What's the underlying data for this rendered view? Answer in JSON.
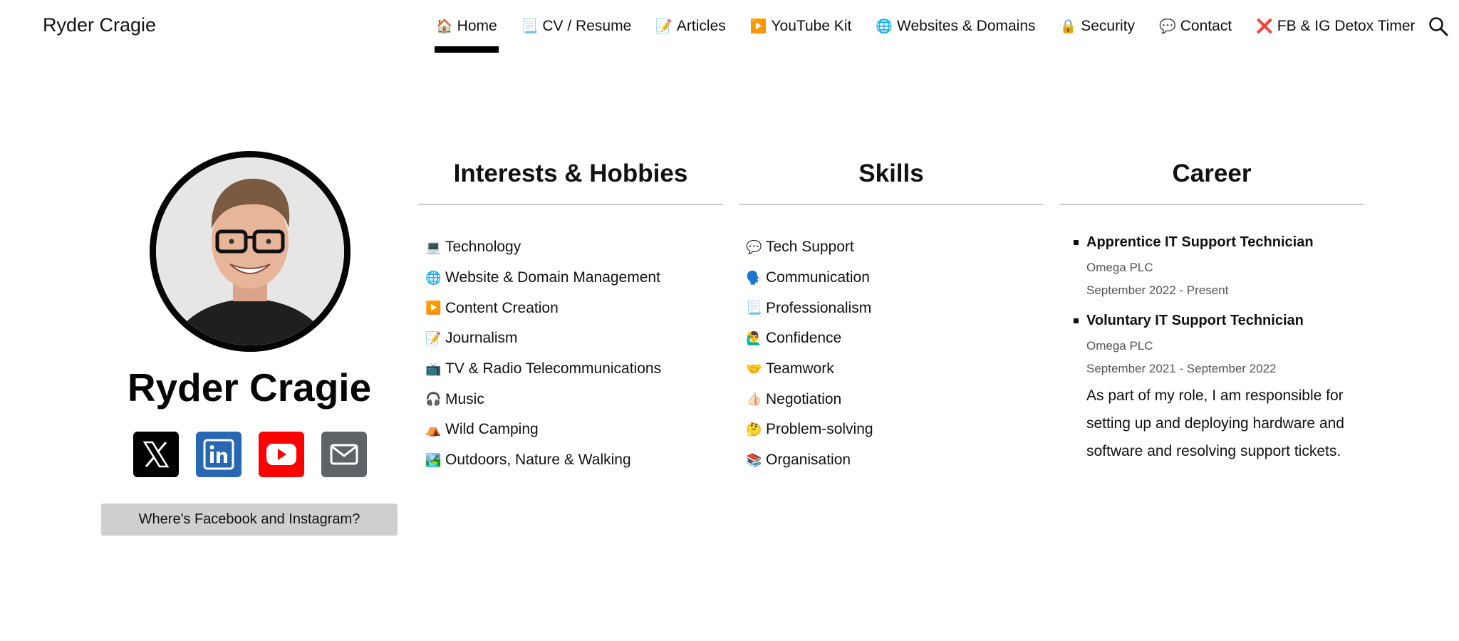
{
  "header": {
    "site_title": "Ryder Cragie",
    "nav": [
      {
        "emoji": "🏠",
        "label": "Home",
        "active": true
      },
      {
        "emoji": "📃",
        "label": "CV / Resume"
      },
      {
        "emoji": "📝",
        "label": "Articles"
      },
      {
        "emoji": "▶️",
        "label": "YouTube Kit"
      },
      {
        "emoji": "🌐",
        "label": "Websites & Domains"
      },
      {
        "emoji": "🔒",
        "label": "Security"
      },
      {
        "emoji": "💬",
        "label": "Contact"
      },
      {
        "emoji": "❌",
        "label": "FB & IG Detox Timer"
      }
    ],
    "search_icon": "search-icon"
  },
  "profile": {
    "name": "Ryder Cragie",
    "socials": [
      "x-icon",
      "linkedin-icon",
      "youtube-icon",
      "email-icon"
    ],
    "facebook_button": "Where's Facebook and Instagram?"
  },
  "interests": {
    "title": "Interests & Hobbies",
    "items": [
      {
        "emoji": "💻",
        "label": "Technology"
      },
      {
        "emoji": "🌐",
        "label": "Website & Domain Management"
      },
      {
        "emoji": "▶️",
        "label": "Content Creation"
      },
      {
        "emoji": "📝",
        "label": "Journalism"
      },
      {
        "emoji": "📺",
        "label": "TV & Radio Telecommunications"
      },
      {
        "emoji": "🎧",
        "label": "Music"
      },
      {
        "emoji": "⛺",
        "label": "Wild Camping"
      },
      {
        "emoji": "🏞️",
        "label": "Outdoors, Nature & Walking"
      }
    ]
  },
  "skills": {
    "title": "Skills",
    "items": [
      {
        "emoji": "💬",
        "label": "Tech Support"
      },
      {
        "emoji": "🗣️",
        "label": "Communication"
      },
      {
        "emoji": "📃",
        "label": "Professionalism"
      },
      {
        "emoji": "🙋‍♂️",
        "label": "Confidence"
      },
      {
        "emoji": "🤝",
        "label": "Teamwork"
      },
      {
        "emoji": "👍🏻",
        "label": "Negotiation"
      },
      {
        "emoji": "🤔",
        "label": "Problem-solving"
      },
      {
        "emoji": "📚",
        "label": "Organisation"
      }
    ]
  },
  "career": {
    "title": "Career",
    "jobs": [
      {
        "title": "Apprentice IT Support Technician",
        "company": "Omega PLC",
        "dates": "September 2022 - Present"
      },
      {
        "title": "Voluntary IT Support Technician",
        "company": "Omega PLC",
        "dates": "September 2021 - September 2022"
      }
    ],
    "description": "As part of my role, I am responsible for setting up and deploying hardware and software and resolving support tickets."
  },
  "colors": {
    "accent": "#000000",
    "linkedin": "#2867b2",
    "youtube": "#ff0000",
    "email": "#5f6368",
    "button_bg": "#cfcfcf"
  }
}
